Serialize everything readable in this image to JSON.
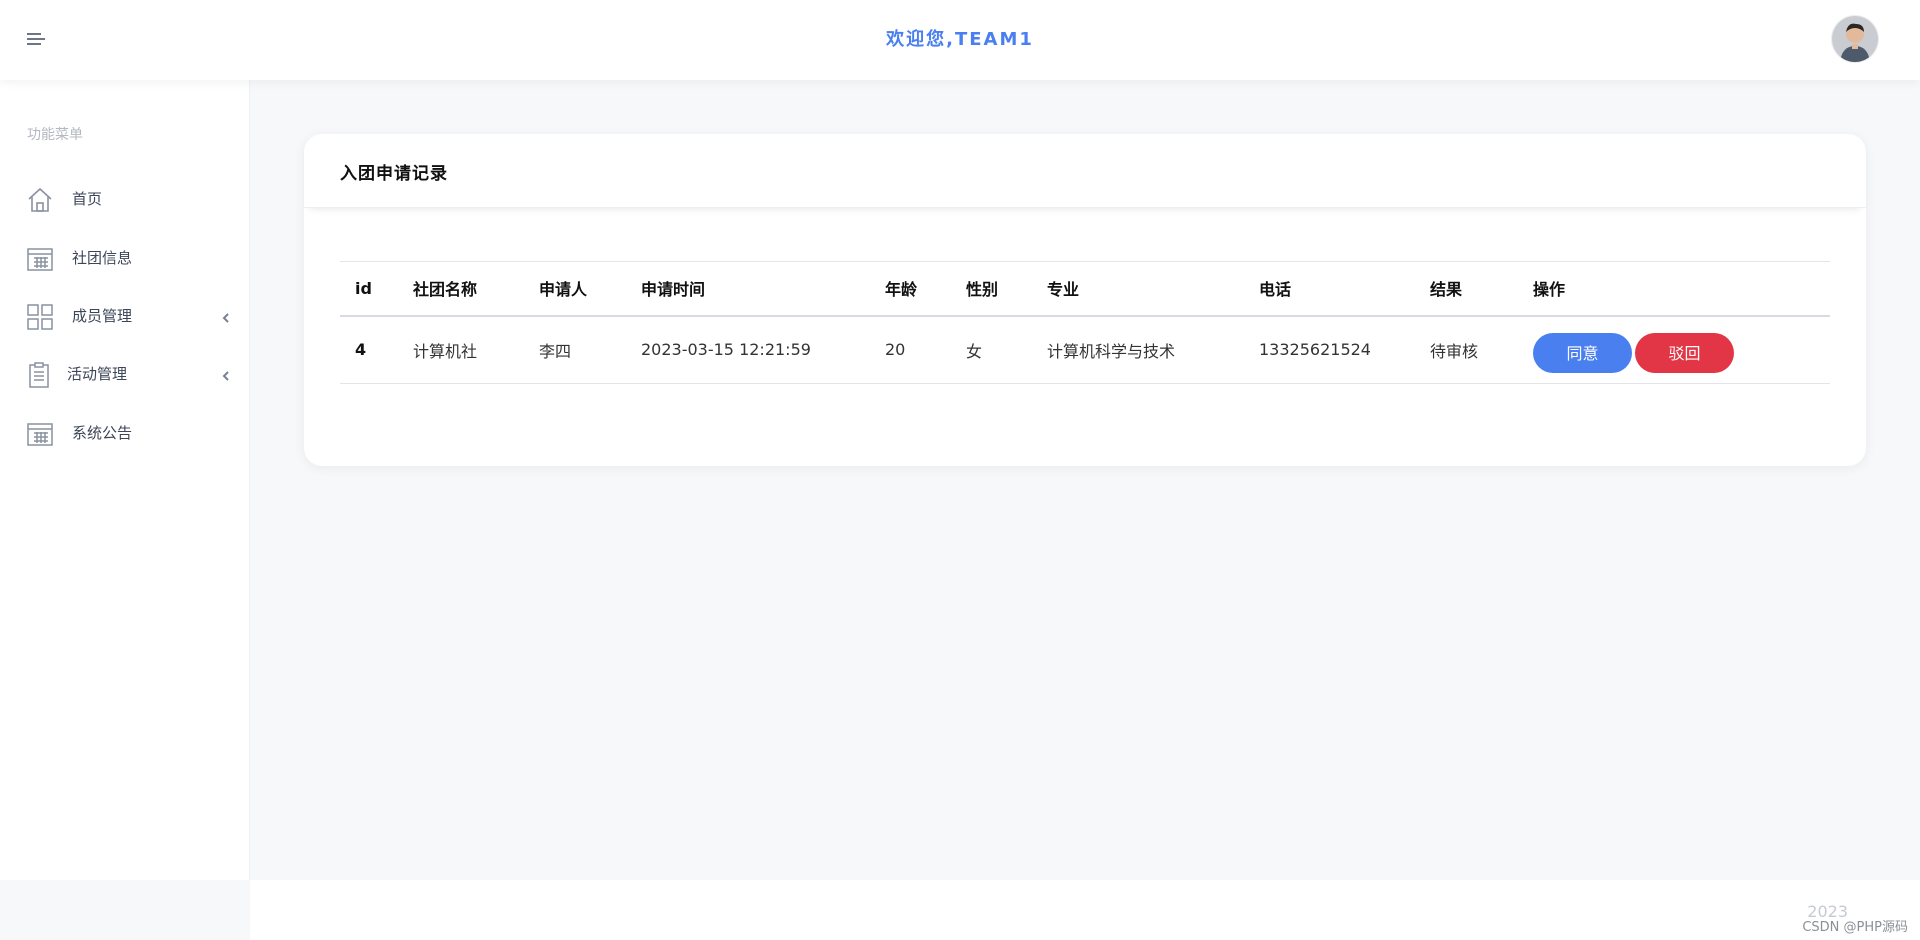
{
  "header": {
    "welcome": "欢迎您,TEAM1",
    "menu_icon": "hamburger-menu-icon",
    "avatar_icon": "user-avatar"
  },
  "sidebar": {
    "caption": "功能菜单",
    "items": [
      {
        "label": "首页",
        "icon": "home-icon",
        "has_submenu": false
      },
      {
        "label": "社团信息",
        "icon": "calendar-grid-icon",
        "has_submenu": false
      },
      {
        "label": "成员管理",
        "icon": "grid-icon",
        "has_submenu": true
      },
      {
        "label": "活动管理",
        "icon": "clipboard-icon",
        "has_submenu": true
      },
      {
        "label": "系统公告",
        "icon": "calendar-grid-icon",
        "has_submenu": false
      }
    ]
  },
  "main": {
    "card_title": "入团申请记录",
    "table": {
      "headers": [
        "id",
        "社团名称",
        "申请人",
        "申请时间",
        "年龄",
        "性别",
        "专业",
        "电话",
        "结果",
        "操作"
      ],
      "rows": [
        {
          "id": "4",
          "club": "计算机社",
          "applicant": "李四",
          "time": "2023-03-15 12:21:59",
          "age": "20",
          "gender": "女",
          "major": "计算机科学与技术",
          "phone": "13325621524",
          "result": "待审核",
          "actions": {
            "agree": "同意",
            "reject": "驳回"
          }
        }
      ]
    }
  },
  "footer": {
    "year": "2023",
    "watermark": "CSDN @PHP源码"
  },
  "colors": {
    "accent": "#4a7ff0",
    "danger": "#e23545",
    "background": "#f7f8fa"
  }
}
